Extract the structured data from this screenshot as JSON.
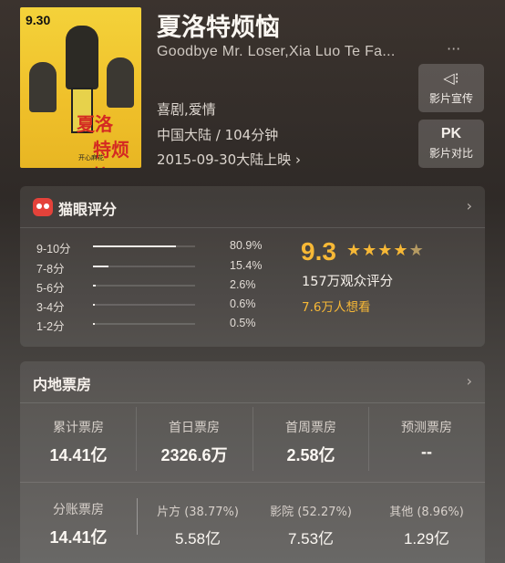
{
  "movie": {
    "poster_date": "9.30",
    "poster_title_1": "夏洛",
    "poster_title_2": "特烦恼",
    "poster_tagline": "开心麻花",
    "title": "夏洛特烦恼",
    "subtitle": "Goodbye Mr. Loser,Xia Luo Te Fa...",
    "more": "···",
    "genre": "喜剧,爱情",
    "region_runtime": "中国大陆 / 104分钟",
    "release": "2015-09-30大陆上映 ›"
  },
  "side_buttons": {
    "promo_icon": "◁⁝",
    "promo_label": "影片宣传",
    "pk_icon": "PK",
    "pk_label": "影片对比"
  },
  "rating": {
    "section_title": "猫眼评分",
    "chevron": "›",
    "distribution": [
      {
        "label": "9-10分",
        "percent": "80.9%",
        "fraction": 0.809
      },
      {
        "label": "7-8分",
        "percent": "15.4%",
        "fraction": 0.154
      },
      {
        "label": "5-6分",
        "percent": "2.6%",
        "fraction": 0.026
      },
      {
        "label": "3-4分",
        "percent": "0.6%",
        "fraction": 0.006
      },
      {
        "label": "1-2分",
        "percent": "0.5%",
        "fraction": 0.005
      }
    ],
    "score": "9.3",
    "stars": 4.65,
    "review_count": "157万观众评分",
    "want_count": "7.6万人想看"
  },
  "box_office": {
    "section_title": "内地票房",
    "chevron": "›",
    "row1": [
      {
        "label": "累计票房",
        "value": "14.41亿"
      },
      {
        "label": "首日票房",
        "value": "2326.6万"
      },
      {
        "label": "首周票房",
        "value": "2.58亿"
      },
      {
        "label": "预测票房",
        "value": "--"
      }
    ],
    "row2": [
      {
        "label": "分账票房",
        "value": "14.41亿"
      },
      {
        "label": "片方 (38.77%)",
        "value": "5.58亿"
      },
      {
        "label": "影院 (52.27%)",
        "value": "7.53亿"
      },
      {
        "label": "其他 (8.96%)",
        "value": "1.29亿"
      }
    ]
  },
  "colors": {
    "accent": "#f7b836",
    "brand_red": "#e4423a"
  }
}
